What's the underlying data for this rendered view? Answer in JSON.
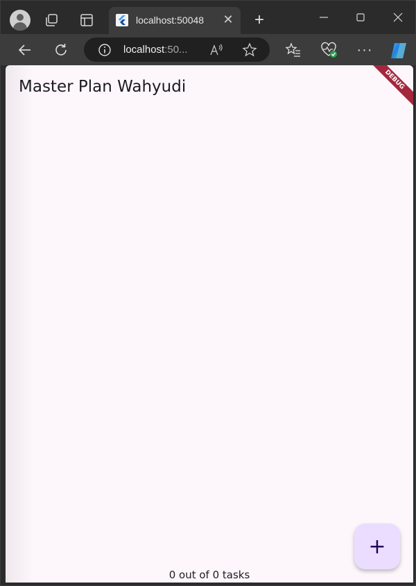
{
  "browser": {
    "tab": {
      "title": "localhost:50048",
      "close_glyph": "✕",
      "favicon": "flutter-icon"
    },
    "new_tab_glyph": "+",
    "address": {
      "host": "localhost",
      "suffix": ":50...",
      "site_info_icon": "info-icon"
    },
    "more_glyph": "···",
    "icons": [
      "profile-icon",
      "tab-actions-icon",
      "vertical-tabs-icon",
      "minimize-icon",
      "maximize-icon",
      "close-icon",
      "back-icon",
      "reload-icon",
      "read-aloud-icon",
      "favorite-star-icon",
      "favorites-icon",
      "browser-essentials-icon",
      "copilot-icon"
    ]
  },
  "app": {
    "title": "Master Plan Wahyudi",
    "debug_banner": "DEBUG",
    "footer": "0 out of 0 tasks",
    "fab_glyph": "+",
    "colors": {
      "background": "#fdf7fc",
      "fab": "#eaddff",
      "banner": "#a3283d"
    }
  }
}
